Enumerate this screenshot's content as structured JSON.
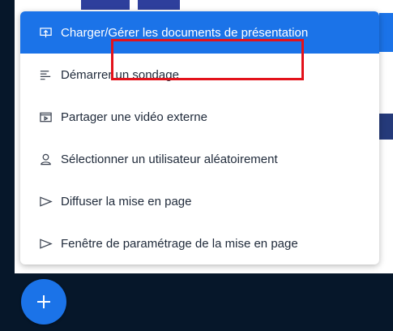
{
  "menu": {
    "items": [
      {
        "label": "Charger/Gérer les documents de présentation",
        "icon": "presentation-upload-icon",
        "active": true
      },
      {
        "label": "Démarrer un sondage",
        "icon": "poll-icon",
        "active": false
      },
      {
        "label": "Partager une vidéo externe",
        "icon": "external-video-icon",
        "active": false
      },
      {
        "label": "Sélectionner un utilisateur aléatoirement",
        "icon": "user-icon",
        "active": false
      },
      {
        "label": "Diffuser la mise en page",
        "icon": "play-outline-icon",
        "active": false
      },
      {
        "label": "Fenêtre de paramétrage de la mise en page",
        "icon": "play-outline-icon",
        "active": false
      }
    ]
  },
  "fab": {
    "icon": "plus-icon"
  },
  "colors": {
    "accent": "#1b73e8",
    "highlight": "#e3121b",
    "dark_bg": "#06172a"
  }
}
